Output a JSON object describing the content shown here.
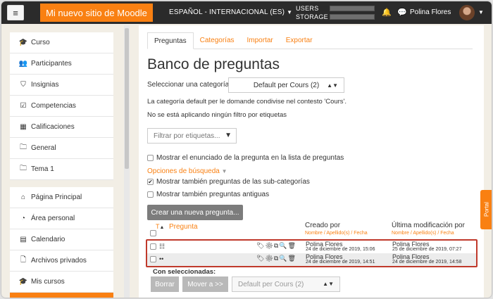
{
  "navbar": {
    "menu_icon": "hamburger-icon",
    "brand": "Mi nuevo sitio de Moodle",
    "language": "ESPAÑOL - INTERNACIONAL (ES)",
    "users_label": "USERS",
    "storage_label": "STORAGE",
    "user_name": "Polina Flores"
  },
  "sidebar": {
    "items": [
      {
        "label": "Curso",
        "icon": "graduation-cap-icon",
        "glyph": "🎓"
      },
      {
        "label": "Participantes",
        "icon": "users-icon",
        "glyph": "👥"
      },
      {
        "label": "Insignias",
        "icon": "shield-icon",
        "glyph": "⛉"
      },
      {
        "label": "Competencias",
        "icon": "check-square-icon",
        "glyph": "☑"
      },
      {
        "label": "Calificaciones",
        "icon": "table-icon",
        "glyph": "▦"
      },
      {
        "label": "General",
        "icon": "folder-icon",
        "glyph": "🗀"
      },
      {
        "label": "Tema 1",
        "icon": "folder-icon",
        "glyph": "🗀"
      },
      {
        "label": "Página Principal",
        "icon": "home-icon",
        "glyph": "⌂"
      },
      {
        "label": "Área personal",
        "icon": "dashboard-icon",
        "glyph": "◔"
      },
      {
        "label": "Calendario",
        "icon": "calendar-icon",
        "glyph": "▤"
      },
      {
        "label": "Archivos privados",
        "icon": "file-icon",
        "glyph": "🗋"
      },
      {
        "label": "Mis cursos",
        "icon": "graduation-cap-icon",
        "glyph": "🎓"
      }
    ]
  },
  "tabs": [
    "Preguntas",
    "Categorías",
    "Importar",
    "Exportar"
  ],
  "page": {
    "title": "Banco de preguntas",
    "category_label": "Seleccionar una categoría:",
    "category_value": "Default per Cours (2)",
    "category_desc": "La categoría default per le domande condivise nel contesto 'Cours'.",
    "no_filter": "No se está aplicando ningún filtro por etiquetas",
    "tag_filter_placeholder": "Filtrar por etiquetas...",
    "show_text": "Mostrar el enunciado de la pregunta en la lista de preguntas",
    "search_options": "Opciones de búsqueda",
    "show_subcats": "Mostrar también preguntas de las sub-categorías",
    "show_old": "Mostrar también preguntas antiguas",
    "new_question": "Crear una nueva pregunta...",
    "col_type": "T",
    "col_question": "Pregunta",
    "col_created": "Creado por",
    "col_modified": "Última modificación por",
    "sort_created": "Nombre / Apellido(s) / Fecha",
    "sort_modified": "Nombre / Apellido(s) / Fecha",
    "with_selected": "Con seleccionadas:",
    "delete": "Borrar",
    "move_to": "Mover a >>",
    "move_target": "Default per Cours (2)",
    "portal_tab": "Portal"
  },
  "questions": [
    {
      "type_glyph": "☷",
      "type_icon": "multichoice-icon",
      "created_by": "Polina Flores",
      "created_date": "24 de diciembre de 2019, 15:06",
      "modified_by": "Polina Flores",
      "modified_date": "25 de diciembre de 2019, 07:27"
    },
    {
      "type_glyph": "••",
      "type_icon": "ddwtos-icon",
      "created_by": "Polina Flores",
      "created_date": "24 de diciembre de 2019, 14:51",
      "modified_by": "Polina Flores",
      "modified_date": "24 de diciembre de 2019, 14:58"
    }
  ],
  "actions": {
    "glyphs": "🏷⚙⧉🔍🗑"
  },
  "colors": {
    "accent": "#f98012",
    "navbar": "#2b2b2b",
    "highlight": "#c0392b"
  }
}
